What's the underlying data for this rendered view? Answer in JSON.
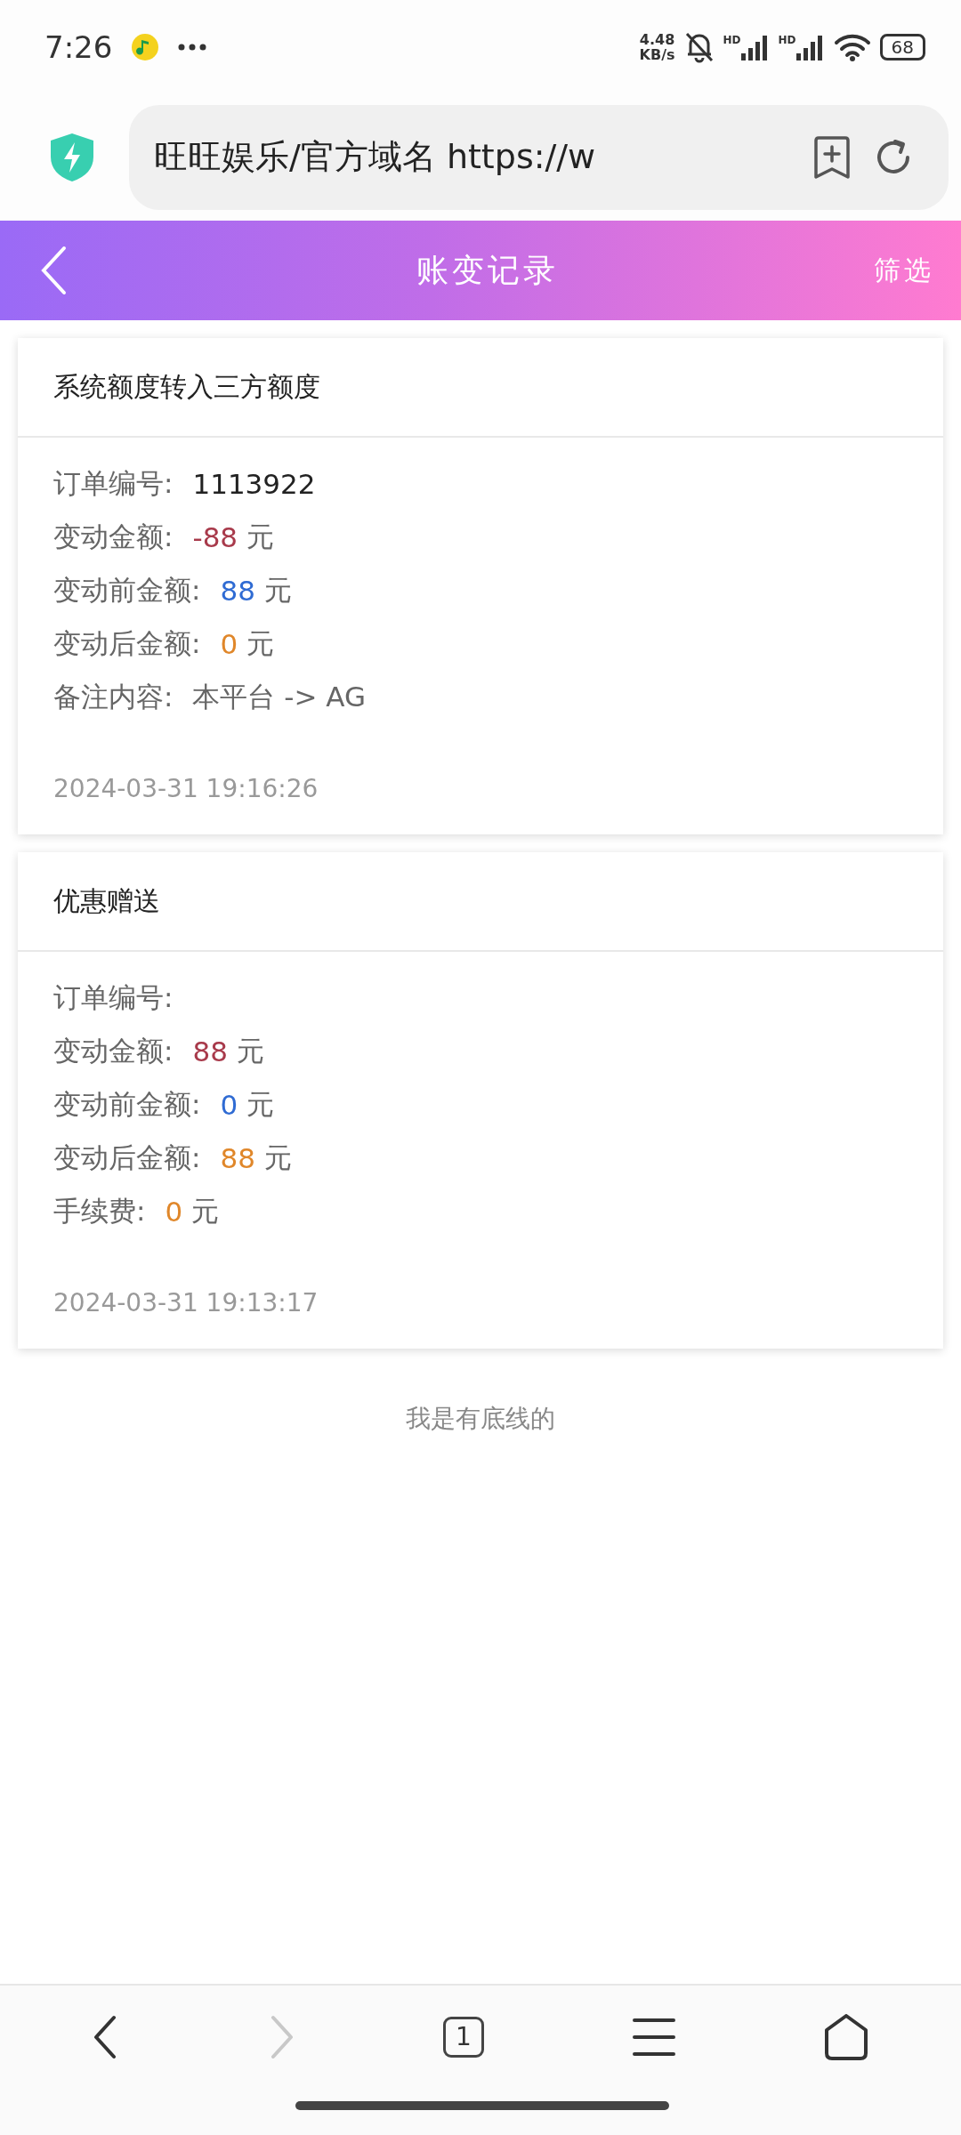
{
  "status_bar": {
    "time": "7:26",
    "speed": "4.48",
    "speed_unit": "KB/s",
    "signal_labels": [
      "HD",
      "HD"
    ],
    "battery": "68"
  },
  "browser": {
    "address": "旺旺娱乐/官方域名 https://w"
  },
  "header": {
    "title": "账变记录",
    "action": "筛选"
  },
  "records": [
    {
      "title": "系统额度转入三方额度",
      "rows": [
        {
          "label": "订单编号:",
          "value": "1113922",
          "color": "#222222"
        },
        {
          "label": "变动金额:",
          "value": "-88",
          "unit": "元",
          "color": "#a83a4b"
        },
        {
          "label": "变动前金额:",
          "value": "88",
          "unit": "元",
          "color": "#2f6bd3"
        },
        {
          "label": "变动后金额:",
          "value": "0",
          "unit": "元",
          "color": "#e0872a"
        },
        {
          "label": "备注内容:",
          "value": "本平台 -> AG",
          "color": "#666666"
        }
      ],
      "time": "2024-03-31 19:16:26"
    },
    {
      "title": "优惠赠送",
      "rows": [
        {
          "label": "订单编号:"
        },
        {
          "label": "变动金额:",
          "value": "88",
          "unit": "元",
          "color": "#a83a4b"
        },
        {
          "label": "变动前金额:",
          "value": "0",
          "unit": "元",
          "color": "#2f6bd3"
        },
        {
          "label": "变动后金额:",
          "value": "88",
          "unit": "元",
          "color": "#e0872a"
        },
        {
          "label": "手续费:",
          "value": "0",
          "unit": "元",
          "color": "#e0872a"
        }
      ],
      "time": "2024-03-31 19:13:17"
    }
  ],
  "footer_note": "我是有底线的",
  "nav": [
    {
      "kind": "back",
      "disabled": false
    },
    {
      "kind": "forward",
      "disabled": true
    },
    {
      "kind": "tabs",
      "count": "1",
      "disabled": false
    },
    {
      "kind": "menu",
      "disabled": false
    },
    {
      "kind": "home",
      "disabled": false
    }
  ]
}
